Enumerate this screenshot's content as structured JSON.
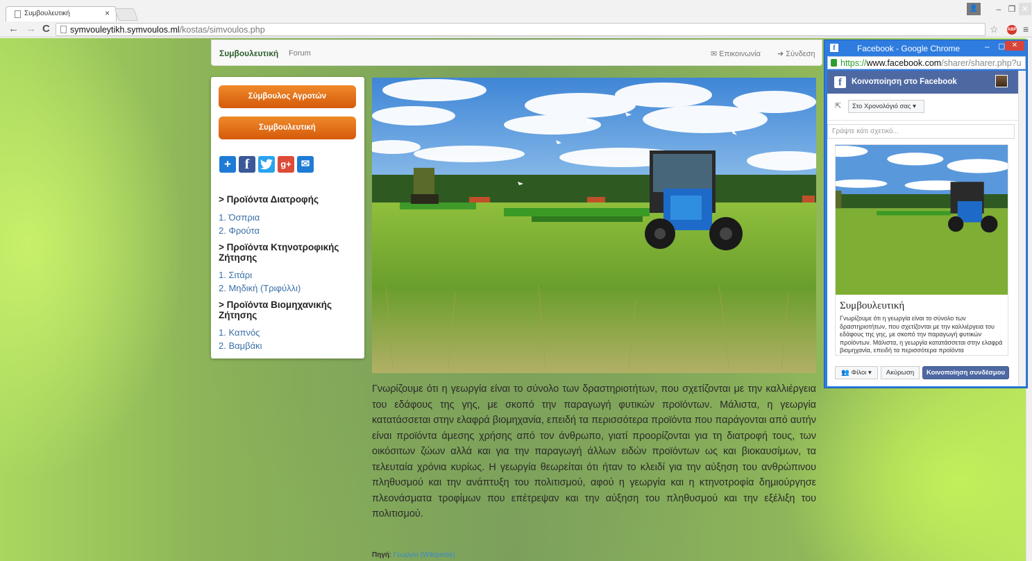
{
  "browser": {
    "tab_title": "Συμβουλευτική",
    "tab_close": "×",
    "url_domain": "symvouleytikh.symvoulos.ml",
    "url_path": "/kostas/simvoulos.php"
  },
  "nav": {
    "brand": "Συμβουλευτική",
    "forum": "Forum",
    "contact": "✉ Επικοινωνία",
    "login": "➜ Σύνδεση"
  },
  "sidebar": {
    "button1": "Σύμβουλος Αγροτών",
    "button2": "Συμβουλευτική",
    "categories": [
      {
        "title": "> Προϊόντα Διατροφής",
        "items": [
          "1. Όσπρια",
          "2. Φρούτα"
        ]
      },
      {
        "title": "> Προϊόντα Κτηνοτροφικής Ζήτησης",
        "items": [
          "1. Σιτάρι",
          "2. Μηδική (Τριφύλλι)"
        ]
      },
      {
        "title": "> Προϊόντα Βιομηχανικής Ζήτησης",
        "items": [
          "1. Καπνός",
          "2. Βαμβάκι"
        ]
      }
    ]
  },
  "article": {
    "body": "Γνωρίζουμε ότι η γεωργία είναι το σύνολο των δραστηριοτήτων, που σχετίζονται με την καλλιέργεια του εδάφους της γης, με σκοπό την παραγωγή φυτικών προϊόντων. Μάλιστα, η γεωργία κατατάσσεται στην ελαφρά βιομηχανία, επειδή τα περισσότερα προϊόντα που παράγονται από αυτήν είναι προϊόντα άμεσης χρήσης από τον άνθρωπο, γιατί προορίζονται για τη διατροφή τους, των οικόσιτων ζώων αλλά και για την παραγωγή άλλων ειδών προϊόντων ως και βιοκαυσίμων, τα τελευταία χρόνια κυρίως. Η γεωργία θεωρείται ότι ήταν το κλειδί για την αύξηση του ανθρώπινου πληθυσμού και την ανάπτυξη του πολιτισμού, αφού η γεωργία και η κτηνοτροφία δημιούργησε πλεονάσματα τροφίμων που επέτρεψαν και την αύξηση του πληθυσμού και την εξέλιξη του πολιτισμού.",
    "source_label": "Πηγή",
    "source_link": "Γεωργία (Wikipedia)"
  },
  "popup": {
    "window_title": "Facebook - Google Chrome",
    "url_scheme": "https://",
    "url_domain": "www.facebook.com",
    "url_rest": "/sharer/sharer.php?u",
    "header": "Κοινοποίηση στο Facebook",
    "timeline_select": "Στο Χρονολόγιό σας ▾",
    "input_placeholder": "Γράψτε κάτι σχετικό...",
    "card_title": "Συμβουλευτική",
    "card_desc": "Γνωρίζουμε ότι η γεωργία είναι το σύνολο των δραστηριοτήτων, που σχετίζονται με την καλλιέργεια του εδάφους της γης, με σκοπό την παραγωγή φυτικών προϊόντων. Μάλιστα, η γεωργία κατατάσσεται στην ελαφρά βιομηχανία, επειδή τα περισσότερα προϊόντα",
    "friends_btn": "👥 Φίλοι ▾",
    "cancel_btn": "Ακύρωση",
    "share_btn": "Κοινοποίηση συνδέσμου"
  },
  "colors": {
    "orange_button": "#e06a14",
    "brand_green": "#2b5e2b",
    "facebook_blue": "#4e69a2",
    "link_blue": "#3a6fa8"
  }
}
